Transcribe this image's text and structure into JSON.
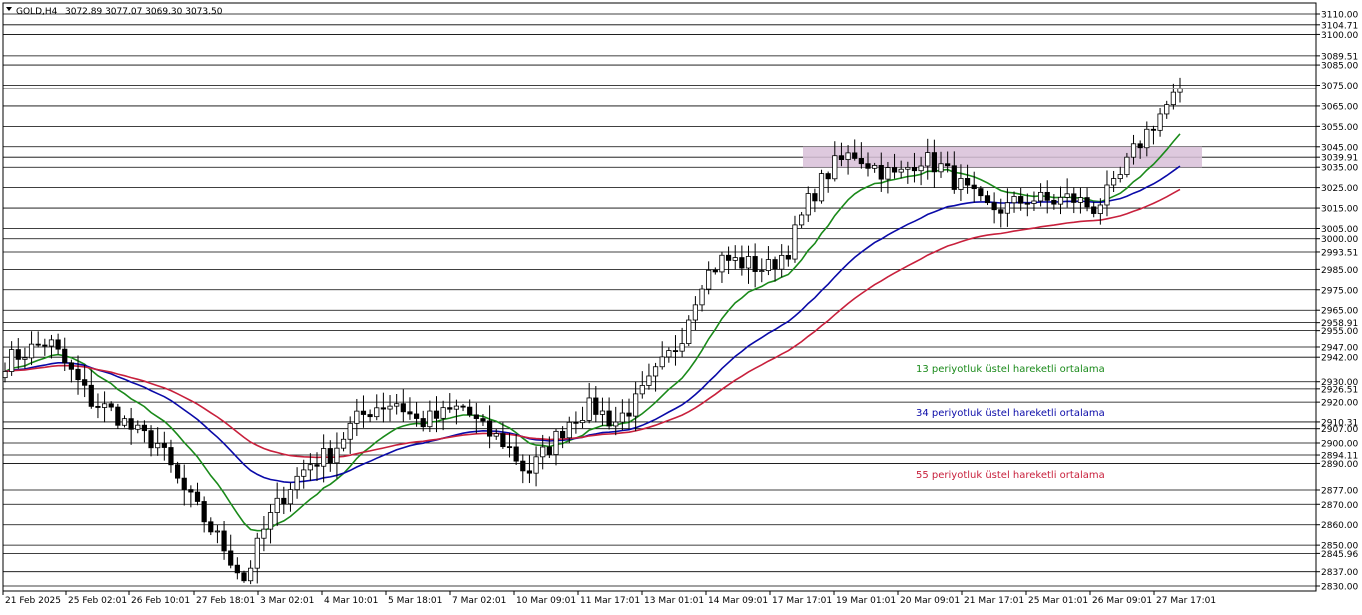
{
  "header": {
    "symbol": "GOLD,H4",
    "ohlc": "3072.89 3077.07 3069.30 3073.50"
  },
  "colors": {
    "background": "#ffffff",
    "gridline": "#000000",
    "candle": "#000000",
    "zone_fill": "#d8bfd8",
    "ema13": "#1a8a1a",
    "ema34": "#0a0aa8",
    "ema55": "#c8203c",
    "last_price_line": "#9a9a9a"
  },
  "chart_data": {
    "type": "candlestick",
    "title": "GOLD,H4",
    "ylim": [
      2830,
      3110
    ],
    "price_levels": [
      3110.0,
      3104.71,
      3100.0,
      3089.51,
      3085.0,
      3075.0,
      3065.0,
      3055.0,
      3045.0,
      3039.91,
      3035.0,
      3025.0,
      3015.0,
      3005.0,
      3000.0,
      2993.51,
      2985.0,
      2975.0,
      2965.0,
      2958.91,
      2955.0,
      2947.0,
      2942.0,
      2930.0,
      2926.51,
      2920.0,
      2910.31,
      2907.0,
      2900.0,
      2894.11,
      2890.0,
      2877.0,
      2870.0,
      2860.0,
      2850.0,
      2845.96,
      2837.0,
      2830.0
    ],
    "price_labels": [
      "3110.00",
      "3104.71",
      "3100.00",
      "3089.51",
      "3085.00",
      "3075.00",
      "3065.00",
      "3055.00",
      "3045.00",
      "3039.91",
      "3035.00",
      "3025.00",
      "3015.00",
      "3005.00",
      "3000.00",
      "2993.51",
      "2985.00",
      "2975.00",
      "2965.00",
      "2958.91",
      "2955.00",
      "2947.00",
      "2942.00",
      "2930.00",
      "2926.51",
      "2920.00",
      "2910.31",
      "2907.00",
      "2900.00",
      "2894.11",
      "2890.00",
      "2877.00",
      "2870.00",
      "2860.00",
      "2850.00",
      "2845.96",
      "2837.00",
      "2830.00"
    ],
    "x_labels": [
      "21 Feb 2025",
      "25 Feb 02:01",
      "26 Feb 10:01",
      "27 Feb 18:01",
      "3 Mar 02:01",
      "4 Mar 10:01",
      "5 Mar 18:01",
      "7 Mar 02:01",
      "10 Mar 09:01",
      "11 Mar 17:01",
      "13 Mar 01:01",
      "14 Mar 09:01",
      "17 Mar 17:01",
      "19 Mar 01:01",
      "20 Mar 09:01",
      "21 Mar 17:01",
      "25 Mar 01:01",
      "26 Mar 09:01",
      "27 Mar 17:01"
    ],
    "resistance_zone": [
      3035.0,
      3045.0
    ],
    "last_price": 3073.5,
    "candle_count": 178,
    "closes_anchor": [
      2940,
      2945,
      2950,
      2935,
      2920,
      2915,
      2905,
      2900,
      2880,
      2865,
      2850,
      2833,
      2860,
      2878,
      2890,
      2895,
      2910,
      2918,
      2920,
      2910,
      2913,
      2918,
      2906,
      2900,
      2885,
      2898,
      2912,
      2918,
      2910,
      2920,
      2935,
      2950,
      2980,
      2990,
      2988,
      2985,
      2995,
      3020,
      3035,
      3042,
      3035,
      3030,
      3040,
      3035,
      3025,
      3015,
      3015,
      3020,
      3018,
      3020,
      3015,
      3025,
      3045,
      3060,
      3073
    ],
    "series": [
      {
        "name": "13 periyotluk üstel hareketli ortalama",
        "ema_period": 13
      },
      {
        "name": "34 periyotluk üstel hareketli ortalama",
        "ema_period": 34
      },
      {
        "name": "55 periyotluk üstel hareketli ortalama",
        "ema_period": 55
      }
    ],
    "grid": true
  },
  "legend": {
    "ema13": "13 periyotluk üstel hareketli ortalama",
    "ema34": "34 periyotluk üstel hareketli ortalama",
    "ema55": "55 periyotluk üstel hareketli ortalama"
  }
}
